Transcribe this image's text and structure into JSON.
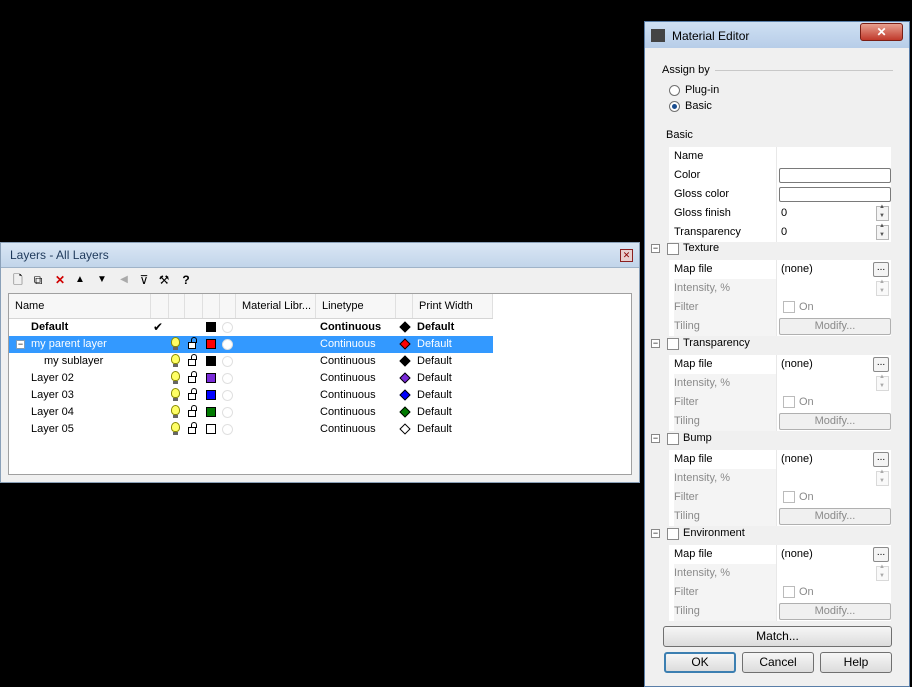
{
  "layers_panel": {
    "title": "Layers - All Layers",
    "columns": [
      "Name",
      "Material Libr...",
      "Linetype",
      "Print Width"
    ],
    "rows": [
      {
        "name": "Default",
        "current": true,
        "color": "#000000",
        "linetype": "Continuous",
        "print_color": "#000000",
        "print_width": "Default",
        "bold": true,
        "selected": false,
        "indent": 0
      },
      {
        "name": "my parent layer",
        "current": false,
        "color": "#ff0000",
        "linetype": "Continuous",
        "print_color": "#ff0000",
        "print_width": "Default",
        "bold": false,
        "selected": true,
        "indent": 0
      },
      {
        "name": "my sublayer",
        "current": false,
        "color": "#000000",
        "linetype": "Continuous",
        "print_color": "#000000",
        "print_width": "Default",
        "bold": false,
        "selected": false,
        "indent": 1
      },
      {
        "name": "Layer 02",
        "current": false,
        "color": "#7a2bd9",
        "linetype": "Continuous",
        "print_color": "#7a2bd9",
        "print_width": "Default",
        "bold": false,
        "selected": false,
        "indent": 0
      },
      {
        "name": "Layer 03",
        "current": false,
        "color": "#0000ff",
        "linetype": "Continuous",
        "print_color": "#0000ff",
        "print_width": "Default",
        "bold": false,
        "selected": false,
        "indent": 0
      },
      {
        "name": "Layer 04",
        "current": false,
        "color": "#007a00",
        "linetype": "Continuous",
        "print_color": "#007a00",
        "print_width": "Default",
        "bold": false,
        "selected": false,
        "indent": 0
      },
      {
        "name": "Layer 05",
        "current": false,
        "color": "#ffffff",
        "linetype": "Continuous",
        "print_color": "#ffffff",
        "print_width": "Default",
        "bold": false,
        "selected": false,
        "indent": 0
      }
    ],
    "checkmark": "✔",
    "toolbar_icons": [
      "new-layer-icon",
      "new-sublayer-icon",
      "delete-icon",
      "move-up-icon",
      "move-down-icon",
      "move-out-icon",
      "filter-icon",
      "tools-icon",
      "help-icon"
    ],
    "toolbar_glyphs": {
      "new": "🗋",
      "sub": "⧉",
      "delete": "✕",
      "up": "▲",
      "down": "▼",
      "out": "◀",
      "filter": "⊽",
      "tools": "⚒",
      "help": "?"
    }
  },
  "material_editor": {
    "title": "Material Editor",
    "close_glyph": "✕",
    "assign_by": {
      "label": "Assign by",
      "options": [
        {
          "label": "Plug-in",
          "selected": false
        },
        {
          "label": "Basic",
          "selected": true
        }
      ]
    },
    "basic": {
      "label": "Basic",
      "name_label": "Name",
      "color_label": "Color",
      "gloss_color_label": "Gloss color",
      "gloss_finish_label": "Gloss finish",
      "gloss_finish_value": "0",
      "transparency_label": "Transparency",
      "transparency_value": "0"
    },
    "sections": [
      {
        "label": "Texture",
        "map_file": "(none)"
      },
      {
        "label": "Transparency",
        "map_file": "(none)"
      },
      {
        "label": "Bump",
        "map_file": "(none)"
      },
      {
        "label": "Environment",
        "map_file": "(none)"
      }
    ],
    "section_labels": {
      "map_file": "Map file",
      "intensity": "Intensity, %",
      "filter": "Filter",
      "on": "On",
      "tiling": "Tiling",
      "modify": "Modify...",
      "ellipsis": "..."
    },
    "buttons": {
      "match": "Match...",
      "ok": "OK",
      "cancel": "Cancel",
      "help": "Help"
    }
  }
}
